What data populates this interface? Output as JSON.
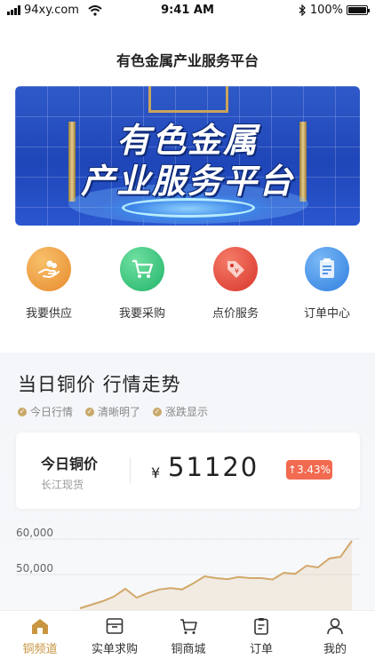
{
  "status_bar": {
    "carrier": "94xy.com",
    "time": "9:41 AM",
    "battery": "100%"
  },
  "page": {
    "title": "有色金属产业服务平台"
  },
  "banner": {
    "line1": "有色金属",
    "line2": "产业服务平台"
  },
  "quick_actions": [
    {
      "label": "我要供应",
      "icon": "supply-hand-icon",
      "color": "#f0a040"
    },
    {
      "label": "我要采购",
      "icon": "shopping-cart-icon",
      "color": "#3fc47e"
    },
    {
      "label": "点价服务",
      "icon": "price-tag-icon",
      "color": "#e54a35"
    },
    {
      "label": "订单中心",
      "icon": "order-note-icon",
      "color": "#3b8de8"
    }
  ],
  "trend": {
    "title": "当日铜价  行情走势",
    "tags": [
      "今日行情",
      "清晰明了",
      "涨跌显示"
    ]
  },
  "price_card": {
    "label": "今日铜价",
    "source": "长江现货",
    "currency": "¥",
    "value": "51120",
    "change": "↑3.43%"
  },
  "chart_data": {
    "type": "area",
    "y_tick_labels": [
      "60,000",
      "50,000"
    ],
    "ylim": [
      40000,
      60000
    ],
    "values": [
      40500,
      41500,
      42500,
      43800,
      46000,
      43500,
      44800,
      45800,
      46200,
      45800,
      47500,
      49500,
      49000,
      48700,
      49300,
      49000,
      49000,
      48600,
      50500,
      50200,
      52500,
      52000,
      54500,
      55000,
      59500
    ]
  },
  "tabbar": [
    {
      "label": "铜频道",
      "icon": "home-icon",
      "active": true
    },
    {
      "label": "实单求购",
      "icon": "inbox-icon",
      "active": false
    },
    {
      "label": "铜商城",
      "icon": "cart-icon",
      "active": false
    },
    {
      "label": "订单",
      "icon": "clipboard-icon",
      "active": false
    },
    {
      "label": "我的",
      "icon": "user-icon",
      "active": false
    }
  ]
}
